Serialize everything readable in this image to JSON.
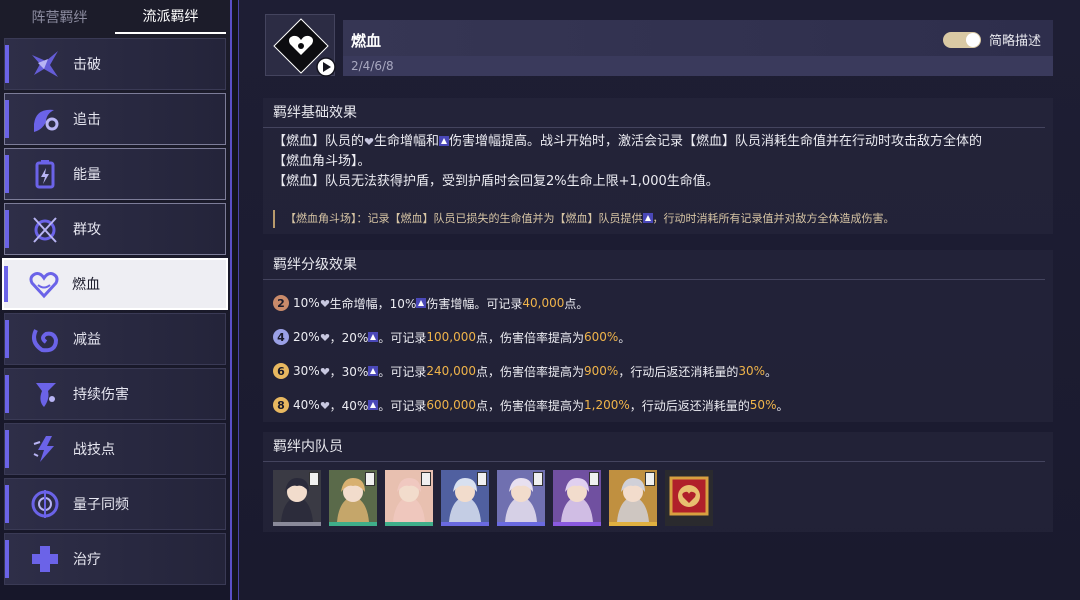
{
  "sidebar": {
    "tabs": [
      "阵营羁绊",
      "流派羁绊"
    ],
    "items": [
      {
        "label": "击破",
        "icon": "break-icon"
      },
      {
        "label": "追击",
        "icon": "follow-up-icon"
      },
      {
        "label": "能量",
        "icon": "energy-battery-icon"
      },
      {
        "label": "群攻",
        "icon": "aoe-icon"
      },
      {
        "label": "燃血",
        "icon": "heart-icon"
      },
      {
        "label": "减益",
        "icon": "debuff-swirl-icon"
      },
      {
        "label": "持续伤害",
        "icon": "dot-icon"
      },
      {
        "label": "战技点",
        "icon": "skill-point-icon"
      },
      {
        "label": "量子同频",
        "icon": "quantum-icon"
      },
      {
        "label": "治疗",
        "icon": "heal-cross-icon"
      }
    ]
  },
  "header": {
    "title": "燃血",
    "thresholds": "2/4/6/8",
    "toggle_label": "简略描述",
    "toggle_on": true
  },
  "basic": {
    "title": "羁绊基础效果",
    "line1_a": "【燃血】队员的",
    "line1_b": "生命增幅和",
    "line1_c": "伤害增幅提高。战斗开始时，激活会记录【燃血】队员消耗生命值并在行动时攻击敌方全体的",
    "line2": "【燃血角斗场】。",
    "line3": "【燃血】队员无法获得护盾，受到护盾时会回复2%生命上限+1,000生命值。",
    "note_a": "【燃血角斗场】：记录【燃血】队员已损失的生命值并为【燃血】队员提供",
    "note_b": "，行动时消耗所有记录值并对敌方全体造成伤害。"
  },
  "tiers": {
    "title": "羁绊分级效果",
    "rows": [
      {
        "badge": "2",
        "badge_color": "#c98a6a",
        "a": "10%",
        "b": "生命增幅，10%",
        "c": "伤害增幅。可记录",
        "num": "40,000",
        "d": "点。",
        "mult": "",
        "e": "",
        "refund": "",
        "f": ""
      },
      {
        "badge": "4",
        "badge_color": "#9aa0e6",
        "a": "20%",
        "b": "，20%",
        "c": "。可记录",
        "num": "100,000",
        "d": "点，伤害倍率提高为",
        "mult": "600%",
        "e": "。",
        "refund": "",
        "f": ""
      },
      {
        "badge": "6",
        "badge_color": "#e8b860",
        "a": "30%",
        "b": "，30%",
        "c": "。可记录",
        "num": "240,000",
        "d": "点，伤害倍率提高为",
        "mult": "900%",
        "e": "，行动后返还消耗量的",
        "refund": "30%",
        "f": "。"
      },
      {
        "badge": "8",
        "badge_color": "#e8b860",
        "a": "40%",
        "b": "，40%",
        "c": "。可记录",
        "num": "600,000",
        "d": "点，伤害倍率提高为",
        "mult": "1,200%",
        "e": "，行动后返还消耗量的",
        "refund": "50%",
        "f": "。"
      }
    ]
  },
  "members": {
    "title": "羁绊内队员",
    "list": [
      {
        "rarity_color": "#8a8a9a",
        "bg": "#3a3a44",
        "hair": "#2a2a3a"
      },
      {
        "rarity_color": "#3fae8a",
        "bg": "#5a6a4a",
        "hair": "#d8b070"
      },
      {
        "rarity_color": "#3fae8a",
        "bg": "#e8c0b0",
        "hair": "#f0c8c0"
      },
      {
        "rarity_color": "#6a6ae0",
        "bg": "#5060a0",
        "hair": "#d8e0f0"
      },
      {
        "rarity_color": "#6a6ae0",
        "bg": "#7070b0",
        "hair": "#e8e0f0"
      },
      {
        "rarity_color": "#8a5ae0",
        "bg": "#7050a0",
        "hair": "#e0d0f0"
      },
      {
        "rarity_color": "#e0b040",
        "bg": "#c09040",
        "hair": "#d0d0d8"
      }
    ]
  }
}
